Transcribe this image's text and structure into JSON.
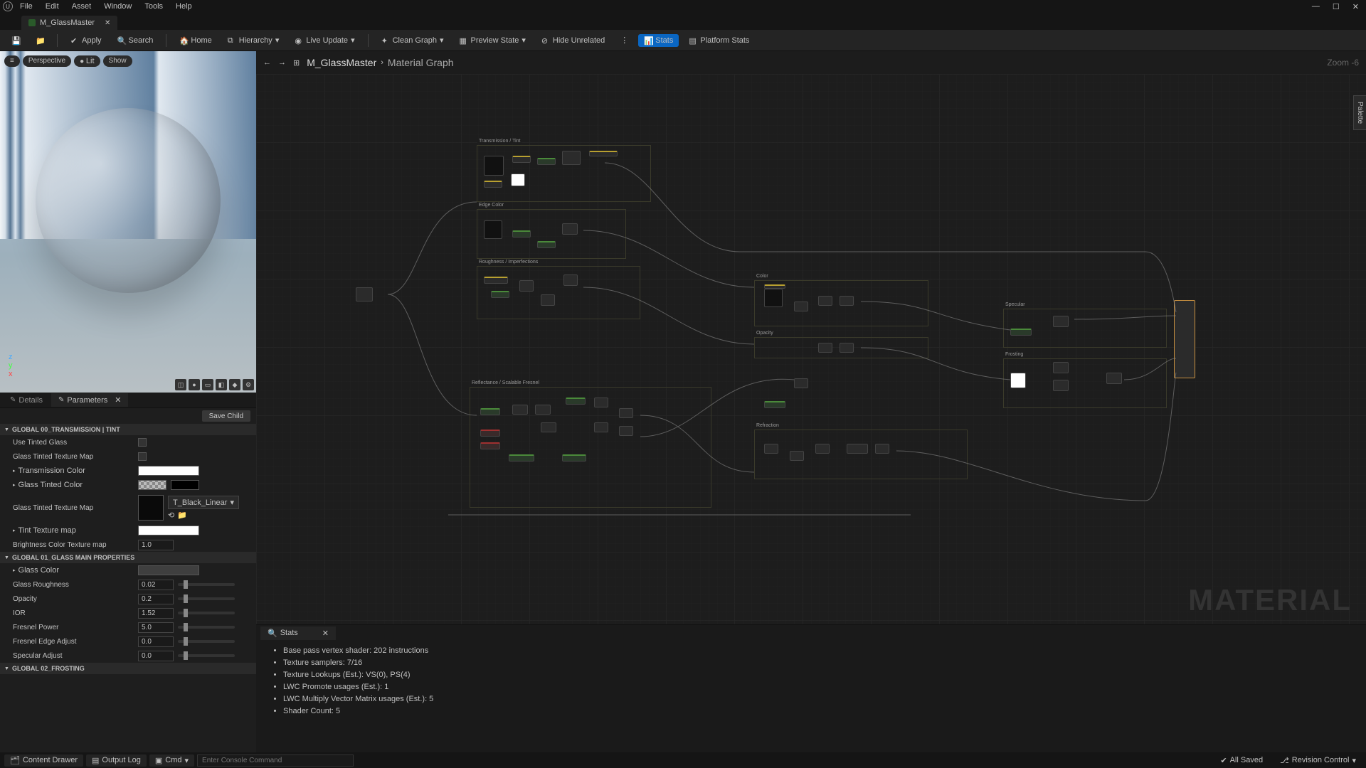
{
  "menu": {
    "file": "File",
    "edit": "Edit",
    "asset": "Asset",
    "window": "Window",
    "tools": "Tools",
    "help": "Help"
  },
  "window_controls": {
    "min": "—",
    "max": "☐",
    "close": "✕"
  },
  "tab": {
    "name": "M_GlassMaster",
    "close": "✕"
  },
  "toolbar": {
    "save": "",
    "browse": "",
    "apply": "Apply",
    "search": "Search",
    "home": "Home",
    "hierarchy": "Hierarchy",
    "live_update": "Live Update",
    "clean_graph": "Clean Graph",
    "preview_state": "Preview State",
    "hide_unrelated": "Hide Unrelated",
    "stats": "Stats",
    "platform_stats": "Platform Stats"
  },
  "viewport": {
    "menu": "≡",
    "perspective": "Perspective",
    "lit": "Lit",
    "show": "Show"
  },
  "panel_tabs": {
    "details": "Details",
    "parameters": "Parameters",
    "close": "✕"
  },
  "save_child": "Save Child",
  "groups": {
    "g0": "GLOBAL 00_TRANSMISSION | TINT",
    "g1": "GLOBAL 01_GLASS MAIN PROPERTIES",
    "g2": "GLOBAL 02_FROSTING"
  },
  "params": {
    "use_tinted": "Use Tinted Glass",
    "tinted_tex_map_chk": "Glass Tinted Texture Map",
    "trans_color": "Transmission Color",
    "tinted_color": "Glass Tinted Color",
    "tinted_tex_map": "Glass Tinted Texture Map",
    "tex_name": "T_Black_Linear",
    "tint_tex_map": "Tint Texture map",
    "brightness_tex": "Brightness Color Texture map",
    "brightness_val": "1.0",
    "glass_color": "Glass Color",
    "glass_rough": "Glass Roughness",
    "rough_val": "0.02",
    "opacity": "Opacity",
    "opacity_val": "0.2",
    "ior": "IOR",
    "ior_val": "1.52",
    "fresnel_power": "Fresnel Power",
    "fresnel_power_val": "5.0",
    "fresnel_edge": "Fresnel Edge Adjust",
    "fresnel_edge_val": "0.0",
    "specular_adj": "Specular Adjust",
    "specular_adj_val": "0.0"
  },
  "graph": {
    "back": "←",
    "fwd": "→",
    "grid": "⊞",
    "asset": "M_GlassMaster",
    "sep": "›",
    "title": "Material Graph",
    "zoom": "Zoom -6",
    "watermark": "MATERIAL",
    "palette": "Palette"
  },
  "node_groups": {
    "transmission": "Transmission / Tint",
    "edge": "Edge Color",
    "rough": "Roughness / Imperfections",
    "fresnel": "Reflectance / Scalable Fresnel",
    "color": "Color",
    "opacity": "Opacity",
    "refraction": "Refraction",
    "specular": "Specular",
    "frosting": "Frosting"
  },
  "stats": {
    "tab": "Stats",
    "close": "✕",
    "l1": "Base pass vertex shader: 202 instructions",
    "l2": "Texture samplers: 7/16",
    "l3": "Texture Lookups (Est.): VS(0), PS(4)",
    "l4": "LWC Promote usages (Est.): 1",
    "l5": "LWC Multiply Vector Matrix usages (Est.): 5",
    "l6": "Shader Count: 5"
  },
  "status": {
    "content_drawer": "Content Drawer",
    "output_log": "Output Log",
    "cmd": "Cmd",
    "cmd_placeholder": "Enter Console Command",
    "all_saved": "All Saved",
    "revision": "Revision Control"
  }
}
